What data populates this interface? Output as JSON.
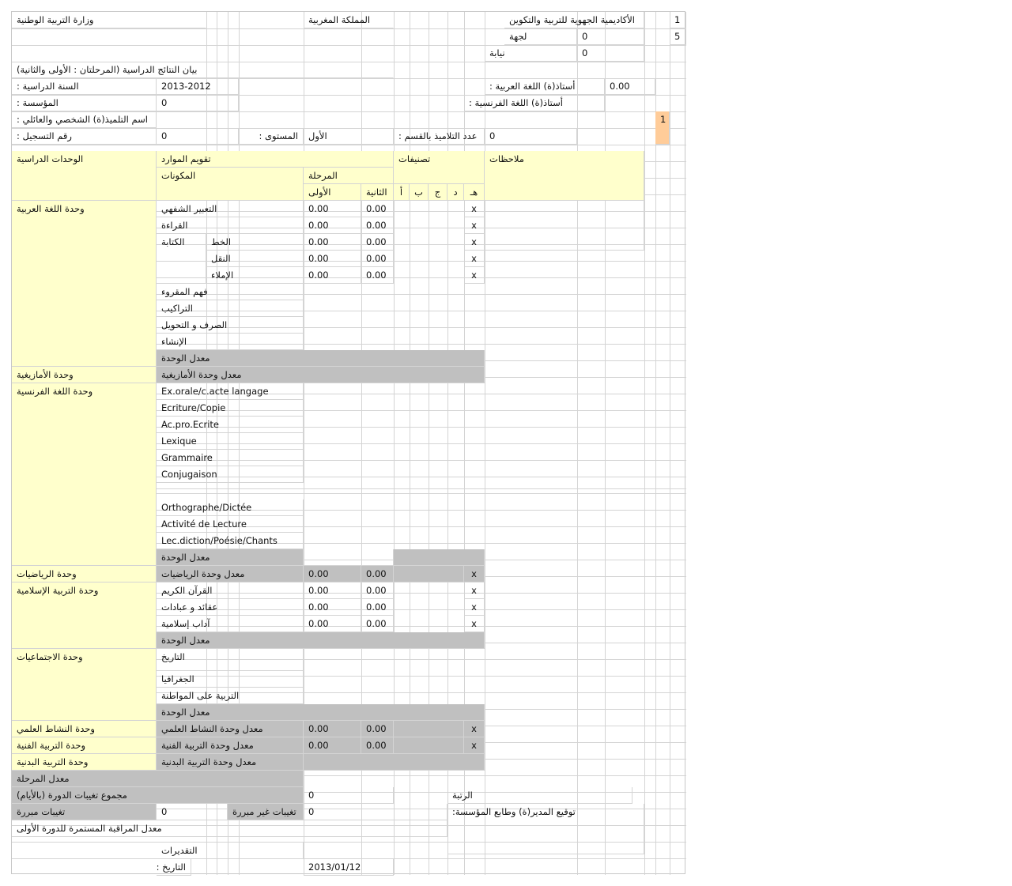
{
  "header": {
    "ministry": "وزارة التربية الوطنية",
    "kingdom": "المملكة المغربية",
    "academy": "الأكاديمية الجهوية للتربية والتكوين",
    "region_label": "لجهة",
    "region_value": "0",
    "province_label": "نيابة",
    "province_value": "0",
    "side_num_1": "1",
    "side_num_2": "5"
  },
  "info": {
    "report_title": "بيان النتائج الدراسية (المرحلتان : الأولى والثانية)",
    "year_label": "السنة الدراسية :",
    "year_value": "2013-2012",
    "arabic_teacher_label": "أستاذ(ة) اللغة العربية :",
    "arabic_teacher_value": "0.00",
    "school_label": "المؤسسة :",
    "school_value": "0",
    "french_teacher_label": "أستاذ(ة) اللغة الفرنسية :",
    "student_label": "اسم التلميذ(ة) الشخصي والعائلي :",
    "student_index": "1",
    "reg_label": "رقم التسجيل :",
    "reg_value": "0",
    "level_label": "المستوى :",
    "level_value": "الأول",
    "class_count_label": "عدد التلاميذ بالقسم :",
    "class_count_value": "0"
  },
  "table_header": {
    "units": "الوحدات الدراسية",
    "resources": "تقويم الموارد",
    "components": "المكونات",
    "stage": "المرحلة",
    "stage1": "الأولى",
    "stage2": "الثانية",
    "classifications": "تصنيفات",
    "grades": [
      "أ",
      "ب",
      "ج",
      "د",
      "هـ"
    ],
    "notes": "ملاحظات"
  },
  "rows": {
    "arabic_unit": "وحدة اللغة العربية",
    "oral": "التعبير الشفهي",
    "reading": "القراءة",
    "writing": "الكتابة",
    "calligraphy": "الخط",
    "copying": "النقل",
    "dictation": "الإملاء",
    "comprehension": "فهم المقروء",
    "structures": "التراكيب",
    "morphology": "الصرف و التحويل",
    "composition": "الإنشاء",
    "unit_avg": "معدل الوحدة",
    "amazigh_unit": "وحدة الأمازيغية",
    "amazigh_avg": "معدل وحدة الأمازيغية",
    "french_unit": "وحدة اللغة الفرنسية",
    "fr_oral": "Ex.orale/c.acte langage",
    "fr_writing": "Ecriture/Copie",
    "fr_acpro": "Ac.pro.Ecrite",
    "fr_lexique": "Lexique",
    "fr_grammaire": "Grammaire",
    "fr_conjugaison": "Conjugaison",
    "fr_orthographe": "Orthographe/Dictée",
    "fr_lecture": "Activité de Lecture",
    "fr_diction": "Lec.diction/Poésie/Chants",
    "math_unit": "وحدة الرياضيات",
    "math_avg": "معدل وحدة الرياضيات",
    "islamic_unit": "وحدة التربية الإسلامية",
    "quran": "القرآن الكريم",
    "aqaid": "عقائد و عبادات",
    "adab": "آداب إسلامية",
    "social_unit": "وحدة الاجتماعيات",
    "history": "التاريخ",
    "geography": "الجغرافيا",
    "citizenship": "التربية على المواطنة",
    "science_unit": "وحدة النشاط العلمي",
    "science_avg": "معدل وحدة النشاط العلمي",
    "art_unit": "وحدة التربية الفنية",
    "art_avg": "معدل وحدة التربية الفنية",
    "pe_unit": "وحدة التربية البدنية",
    "pe_avg": "معدل وحدة التربية البدنية"
  },
  "values": {
    "zero": "0.00",
    "x": "x"
  },
  "footer": {
    "stage_avg": "معدل المرحلة",
    "absences_total": "مجموع تغيبات الدورة (بالأيام)",
    "absences_total_value": "0",
    "rank": "الرتبة",
    "justified": "تغيبات مبررة",
    "justified_value": "0",
    "unjustified": "تغيبات غير مبررة",
    "unjustified_value": "0",
    "director_sign": "توقيع المدير(ة) وطابع المؤسسة:",
    "continuous_avg": "معدل المراقبة المستمرة للدورة الأولى",
    "appreciations": "التقديرات",
    "date_label": "التاريخ :",
    "date_value": "2013/01/12"
  },
  "colors": {
    "yellow": "#ffffcc",
    "gray": "#c0c0c0",
    "orange": "#ffcc99",
    "grid": "#d4d4d4"
  }
}
